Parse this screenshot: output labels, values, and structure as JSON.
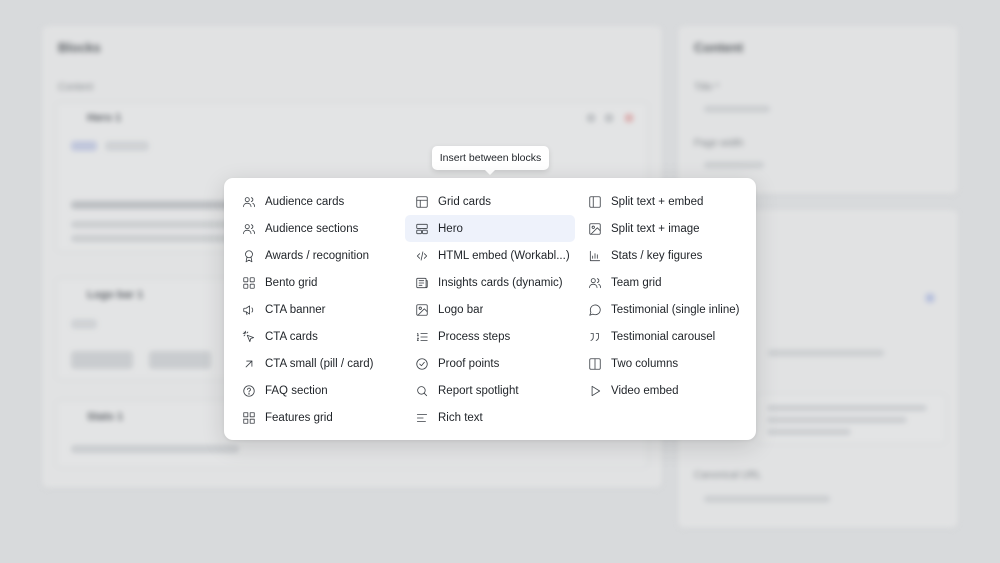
{
  "background": {
    "left_panel": {
      "title": "Blocks",
      "section_label": "Content",
      "cards": [
        {
          "title": "Hero 1"
        },
        {
          "title": "Logo bar 1"
        },
        {
          "title": "Stats 1"
        }
      ]
    },
    "right_panel": {
      "title": "Content",
      "fields": [
        {
          "label": "Title *"
        },
        {
          "label": "Page width"
        },
        {
          "label": "Canonical URL"
        }
      ]
    }
  },
  "tooltip": {
    "text": "Insert between blocks"
  },
  "menu": {
    "columns": [
      [
        {
          "label": "Audience cards",
          "icon": "users-icon"
        },
        {
          "label": "Audience sections",
          "icon": "users-icon"
        },
        {
          "label": "Awards / recognition",
          "icon": "award-icon"
        },
        {
          "label": "Bento grid",
          "icon": "bento-grid-icon"
        },
        {
          "label": "CTA banner",
          "icon": "megaphone-icon"
        },
        {
          "label": "CTA cards",
          "icon": "pointer-click-icon"
        },
        {
          "label": "CTA small (pill / card)",
          "icon": "arrow-up-right-icon"
        },
        {
          "label": "FAQ section",
          "icon": "help-circle-icon"
        },
        {
          "label": "Features grid",
          "icon": "grid-icon"
        }
      ],
      [
        {
          "label": "Grid cards",
          "icon": "table-icon"
        },
        {
          "label": "Hero",
          "icon": "hero-layout-icon",
          "active": true
        },
        {
          "label": "HTML embed (Workabl...)",
          "icon": "code-icon"
        },
        {
          "label": "Insights cards (dynamic)",
          "icon": "newspaper-icon"
        },
        {
          "label": "Logo bar",
          "icon": "image-icon"
        },
        {
          "label": "Process steps",
          "icon": "list-ordered-icon"
        },
        {
          "label": "Proof points",
          "icon": "check-circle-icon"
        },
        {
          "label": "Report spotlight",
          "icon": "search-icon"
        },
        {
          "label": "Rich text",
          "icon": "align-left-icon"
        }
      ],
      [
        {
          "label": "Split text + embed",
          "icon": "panel-left-icon"
        },
        {
          "label": "Split text + image",
          "icon": "image-icon"
        },
        {
          "label": "Stats / key figures",
          "icon": "bar-chart-icon"
        },
        {
          "label": "Team grid",
          "icon": "users-icon"
        },
        {
          "label": "Testimonial (single inline)",
          "icon": "message-circle-icon"
        },
        {
          "label": "Testimonial carousel",
          "icon": "quote-icon"
        },
        {
          "label": "Two columns",
          "icon": "columns-icon"
        },
        {
          "label": "Video embed",
          "icon": "play-icon"
        }
      ]
    ]
  }
}
